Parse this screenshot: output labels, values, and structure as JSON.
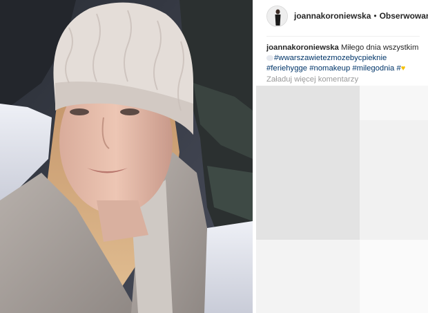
{
  "header": {
    "username": "joannakoroniewska",
    "separator": "•",
    "follow_label": "Obserwowar"
  },
  "caption": {
    "username": "joannakoroniewska",
    "text": "Miłego dnia wszystkim",
    "hashtags": [
      "#wwarszawietezmozebycpieknie",
      "#feriehygge",
      "#nomakeup",
      "#milegodnia",
      "#"
    ]
  },
  "comments": {
    "load_more_label": "Załaduj więcej komentarzy"
  },
  "colors": {
    "hashtag": "#003569",
    "muted": "#999999",
    "heart": "#f5c000"
  },
  "icons": {
    "cloud": "cloud-emoji-icon",
    "heart": "yellow-heart-icon"
  }
}
